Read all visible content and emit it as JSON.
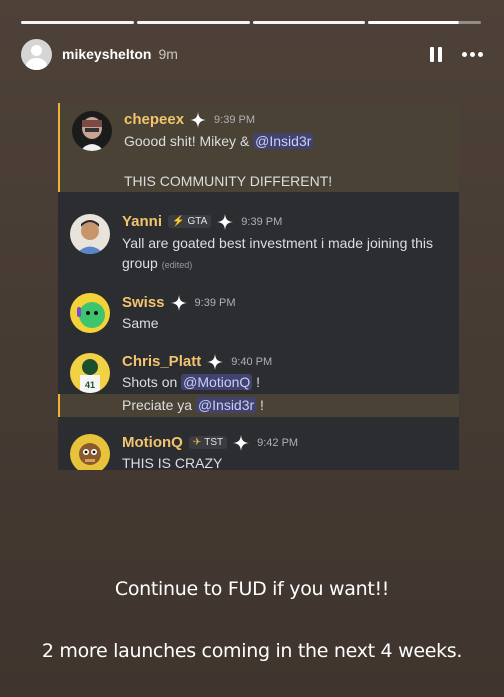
{
  "story": {
    "username": "mikeyshelton",
    "time": "9m",
    "segments": [
      1,
      1,
      1,
      0.8
    ]
  },
  "chat": {
    "messages": [
      {
        "name": "chepeex",
        "time": "9:39 PM",
        "line1_pre": "Goood shit! Mikey & ",
        "line1_mention": "@Insid3r",
        "line2": "THIS COMMUNITY DIFFERENT!"
      },
      {
        "name": "Yanni",
        "tag": "GTA",
        "time": "9:39 PM",
        "line1": "Yall are goated best investment i made joining this",
        "line2": "group",
        "edited": "(edited)"
      },
      {
        "name": "Swiss",
        "time": "9:39 PM",
        "line1": "Same"
      },
      {
        "name": "Chris_Platt",
        "time": "9:40 PM",
        "line1_pre": "Shots on ",
        "line1_mention": "@MotionQ",
        "line1_post": " !",
        "line2_pre": "Preciate ya ",
        "line2_mention": "@Insid3r",
        "line2_post": " !"
      },
      {
        "name": "MotionQ",
        "tag": "TST",
        "time": "9:42 PM",
        "line1": "THIS IS CRAZY"
      }
    ]
  },
  "captions": {
    "line1": "Continue to FUD if you want!!",
    "line2": "2 more launches coming in the next 4 weeks."
  },
  "colors": {
    "highlight_border": "#f0b232",
    "mention_bg": "#41436e",
    "name_gold": "#f2c46d"
  }
}
